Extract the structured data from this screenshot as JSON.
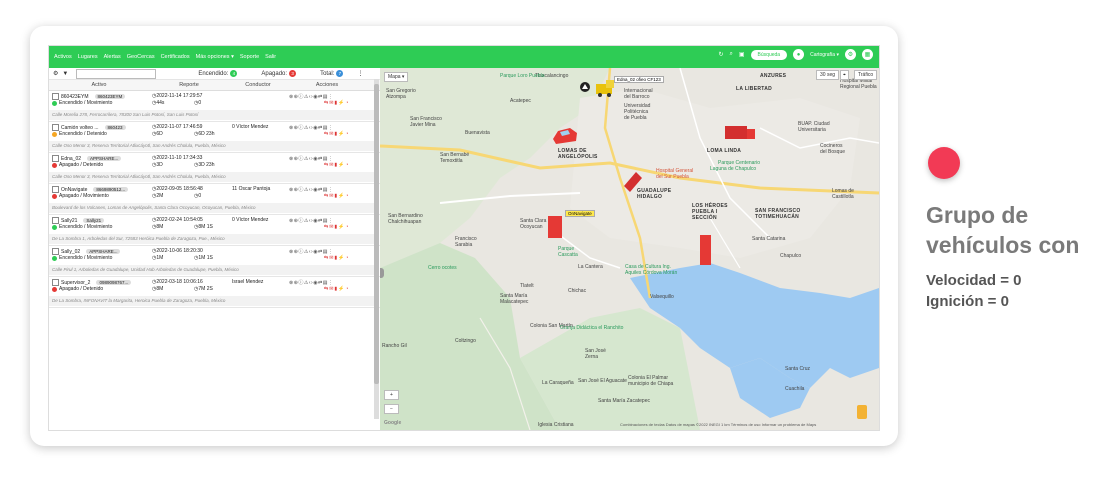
{
  "nav": {
    "items": [
      "Activos",
      "Lugares",
      "Alertas",
      "GeoCercas",
      "Certificados",
      "Más opciones ▾",
      "Soporte",
      "Salir"
    ],
    "search_label": "Búsqueda",
    "user_label": "Cartografía ▾"
  },
  "toolbar": {
    "encendido_label": "Encendido:",
    "encendido_count": "4",
    "apagado_label": "Apagado:",
    "apagado_count": "3",
    "total_label": "Total:",
    "total_count": "7"
  },
  "table": {
    "headers": [
      "Activo",
      "Reporte",
      "Conductor",
      "Acciones"
    ],
    "rows": [
      {
        "name": "860423EYM",
        "tag": "860423EYM",
        "date": "2022-11-14 17:29:57",
        "status": "Encendido / Movimiento",
        "status_color": "#2ecc55",
        "t1": "44s",
        "t2": "0",
        "driver": "",
        "addr": "Calle Morelia 278, Ferrocarrilera, 78300 San Luis Potosí, San Luis Potosí"
      },
      {
        "name": "Camión volteo ...",
        "tag": "860423",
        "date": "2022-11-07 17:46:59",
        "status": "Encendido / Detenido",
        "status_color": "#f5a623",
        "t1": "6D",
        "t2": "6D 23h",
        "driver": "0 Víctor Mendez",
        "addr": "Calle Oso Menor 3, Reserva Territorial Atlixcáyotl, San Andrés Cholula, Puebla, México"
      },
      {
        "name": "Edna_02",
        "tag": "APPSHARE...",
        "date": "2022-11-10 17:34:33",
        "status": "Apagado / Detenido",
        "status_color": "#e53935",
        "t1": "3D",
        "t2": "3D 23h",
        "driver": "",
        "addr": "Calle Oso Menor 3, Reserva Territorial Atlixcáyotl, San Andrés Cholula, Puebla, México"
      },
      {
        "name": "OnNavigate",
        "tag": "8669890512...",
        "date": "2022-09-05 18:56:48",
        "status": "Apagado / Movimiento",
        "status_color": "#e53935",
        "t1": "2M",
        "t2": "0",
        "driver": "11 Oscar Pantoja",
        "addr": "Boulevard de los Volcanes, Lomas de Angelópolis, Santa Clara Ocoyucan, Ocoyucan, Puebla, México"
      },
      {
        "name": "Sally21",
        "tag": "Sally21",
        "date": "2022-02-24 10:54:05",
        "status": "Encendido / Movimiento",
        "status_color": "#2ecc55",
        "t1": "8M",
        "t2": "8M 1S",
        "driver": "0 Víctor Mendez",
        "addr": "De La Sombra 1, Arboledas del Sur, 72583 Heróica Puebla de Zaragoza, Pue., México"
      },
      {
        "name": "Sally_02",
        "tag": "APPSHARE...",
        "date": "2022-10-06 18:20:30",
        "status": "Encendido / Movimiento",
        "status_color": "#2ecc55",
        "t1": "1M",
        "t2": "1M 1S",
        "driver": "",
        "addr": "Calle Pirul 1, Arboledas de Guadalupe, Unidad Hab Arboledas de Guadalupe, Puebla, México"
      },
      {
        "name": "Supervisor_2",
        "tag": "0989098767...",
        "date": "2022-03-18 10:06:16",
        "status": "Apagado / Detenido",
        "status_color": "#e53935",
        "t1": "8M",
        "t2": "7M 2S",
        "driver": "Israel Mendez",
        "addr": "De La Sombra, INFONAVIT la Margarita, Heroica Puebla de Zaragoza, Puebla, México"
      }
    ]
  },
  "map": {
    "type_label": "Mapa ▾",
    "refresh_label": "30 seg",
    "traffic_label": "Tráfico",
    "tooltip": "Edna_02 ofieo CF123",
    "onnavigate_label": "OnNavigate",
    "footer": "Combinaciones de teclas   Datos de mapas ©2022 INEGI   1 km   Términos de uso   Informar un problema de Maps",
    "places": [
      {
        "t": "Tlaxcalancingo",
        "c": ""
      },
      {
        "t": "San Gregorio\nAtzompa",
        "c": ""
      },
      {
        "t": "Acatepec",
        "c": ""
      },
      {
        "t": "Buenavista",
        "c": ""
      },
      {
        "t": "San Francisco\nJavier Mina",
        "c": ""
      },
      {
        "t": "San Bernabé\nTemoxtitla",
        "c": ""
      },
      {
        "t": "San Bernardino\nChalchihuapan",
        "c": ""
      },
      {
        "t": "Francisco\nSarabia",
        "c": ""
      },
      {
        "t": "Santa Clara\nOcoyucan",
        "c": ""
      },
      {
        "t": "Cerro ocotes",
        "c": "green"
      },
      {
        "t": "Tlatelt",
        "c": ""
      },
      {
        "t": "Santa María\nMalacatepec",
        "c": ""
      },
      {
        "t": "Chichac",
        "c": ""
      },
      {
        "t": "Colonia San Martín",
        "c": ""
      },
      {
        "t": "Rancho Gil",
        "c": ""
      },
      {
        "t": "Coltzingo",
        "c": ""
      },
      {
        "t": "San José\nZerna",
        "c": ""
      },
      {
        "t": "San José El Aguacate",
        "c": ""
      },
      {
        "t": "La Caraqueña",
        "c": ""
      },
      {
        "t": "Santa María Zacatepec",
        "c": ""
      },
      {
        "t": "Iglesia Cristiana",
        "c": ""
      },
      {
        "t": "ANZURES",
        "c": "bold"
      },
      {
        "t": "LA LIBERTAD",
        "c": "bold"
      },
      {
        "t": "LOMAS DE\nANGELÓPOLIS",
        "c": "bold"
      },
      {
        "t": "GUADALUPE\nHIDALGO",
        "c": "bold"
      },
      {
        "t": "LOS HÉROES\nPUEBLA I\nSECCIÓN",
        "c": "bold"
      },
      {
        "t": "SAN FRANCISCO\nTOTIMEHUACÁN",
        "c": "bold"
      },
      {
        "t": "LOMA LINDA",
        "c": "bold"
      },
      {
        "t": "Lomas de\nCastillotla",
        "c": ""
      },
      {
        "t": "Santa Catarina",
        "c": ""
      },
      {
        "t": "Chapulco",
        "c": ""
      },
      {
        "t": "Valsequillo",
        "c": ""
      },
      {
        "t": "Cuachila",
        "c": ""
      },
      {
        "t": "Santa Cruz",
        "c": ""
      },
      {
        "t": "Parque Loro Puebla",
        "c": "green"
      },
      {
        "t": "Parque\nCascatta",
        "c": "green"
      },
      {
        "t": "Laguna de Chapulco",
        "c": "green"
      },
      {
        "t": "Granja Didáctica el Ranchito",
        "c": "green"
      },
      {
        "t": "Casa de Cultura Ing.\nAquiles Córdova Morán",
        "c": "green"
      },
      {
        "t": "Hospital General\ndel Sur Puebla",
        "c": "red"
      },
      {
        "t": "BUAP. Ciudad\nUniversitaria",
        "c": ""
      },
      {
        "t": "Parque Centenario",
        "c": "green"
      },
      {
        "t": "Hospital Militar\nRegional Puebla",
        "c": ""
      },
      {
        "t": "Universidad\nPolitécnica\nde Puebla",
        "c": ""
      },
      {
        "t": "Internacional\ndel Barroco",
        "c": ""
      },
      {
        "t": "Cocineros\ndel Bosque",
        "c": ""
      },
      {
        "t": "Colonia El Palmar\nmunicipio de Chiapa",
        "c": ""
      },
      {
        "t": "La Cantera",
        "c": ""
      }
    ]
  },
  "info": {
    "heading": "Grupo de vehículos con",
    "line1": "Velocidad = 0",
    "line2": "Ignición = 0",
    "dot_color": "#f23a55"
  }
}
